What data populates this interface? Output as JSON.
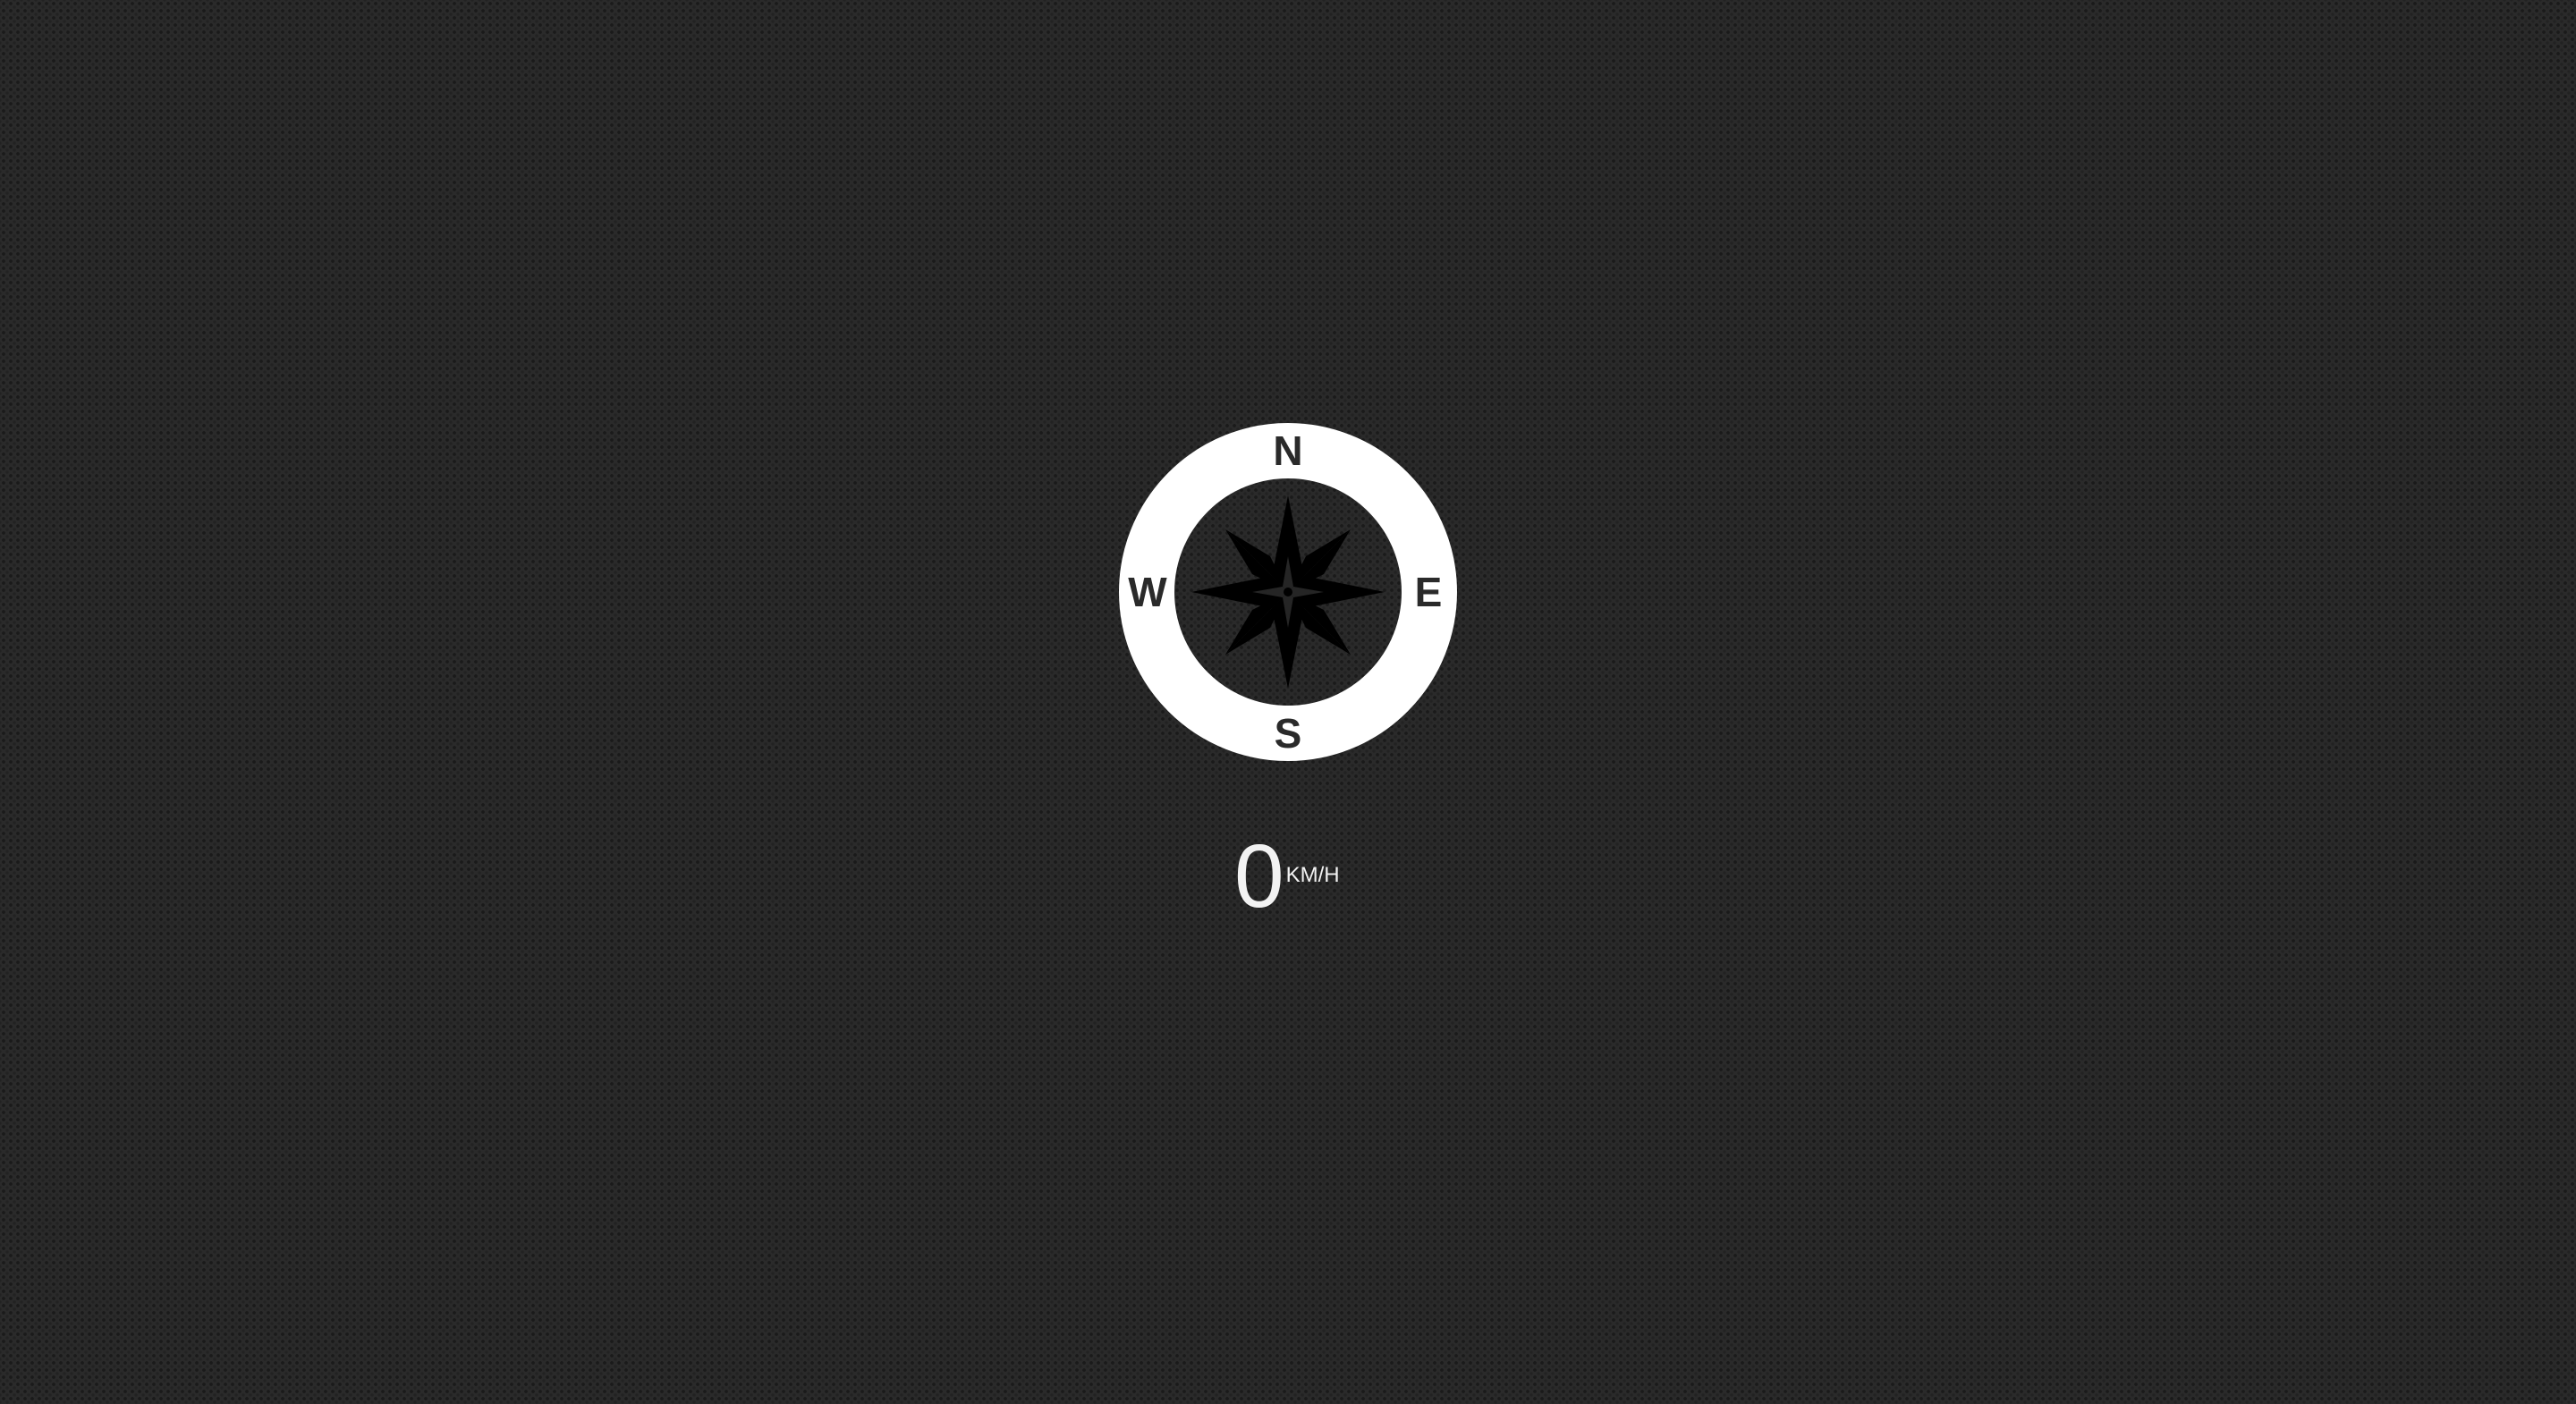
{
  "compass": {
    "icon": "compass-rose-icon",
    "labels": {
      "north": "N",
      "east": "E",
      "south": "S",
      "west": "W"
    },
    "ring_color": "#ffffff",
    "rose_color": "#000000"
  },
  "speed": {
    "value": "0",
    "unit": "KM/H"
  },
  "colors": {
    "background": "#2a2a2a",
    "text": "#f2f2f2"
  }
}
